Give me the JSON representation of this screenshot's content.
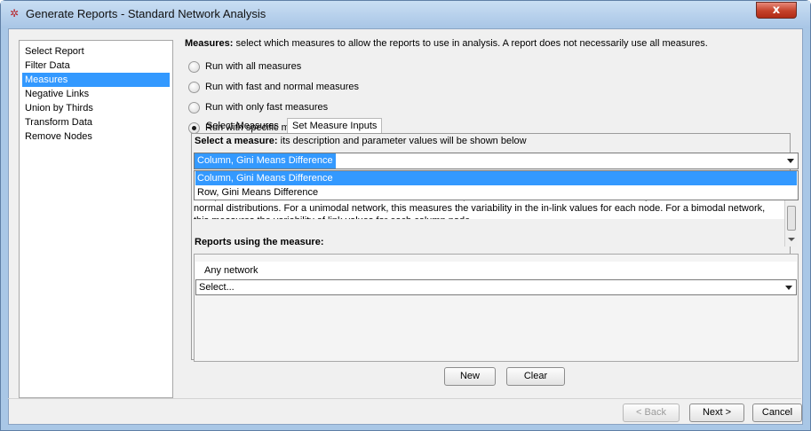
{
  "window": {
    "title": "Generate Reports - Standard Network Analysis",
    "app_icon": "ora-logo-icon",
    "close_glyph": "x"
  },
  "nav": {
    "items": [
      {
        "label": "Select Report",
        "selected": false
      },
      {
        "label": "Filter Data",
        "selected": false
      },
      {
        "label": "Measures",
        "selected": true
      },
      {
        "label": "Negative Links",
        "selected": false
      },
      {
        "label": "Union by Thirds",
        "selected": false
      },
      {
        "label": "Transform Data",
        "selected": false
      },
      {
        "label": "Remove Nodes",
        "selected": false
      }
    ]
  },
  "measures": {
    "heading_bold": "Measures:",
    "heading_rest": " select which measures to allow the reports to use in analysis. A report does not necessarily use all measures.",
    "options": [
      {
        "label": "Run with all measures",
        "checked": false
      },
      {
        "label": "Run with fast and normal measures",
        "checked": false
      },
      {
        "label": "Run with only fast measures",
        "checked": false
      },
      {
        "label": "Run with specific measures",
        "checked": true
      }
    ]
  },
  "tabs": [
    {
      "label": "Select Measures",
      "active": false
    },
    {
      "label": "Set Measure Inputs",
      "active": true
    }
  ],
  "measure_select": {
    "label_bold": "Select a measure:",
    "label_rest": " its description and parameter values will be shown below",
    "current_value": "Column, Gini Means Difference",
    "dropdown_options": [
      {
        "label": "Column, Gini Means Difference",
        "selected": true
      },
      {
        "label": "Row, Gini Means Difference",
        "selected": false
      }
    ],
    "description": "Computes the Gini Means Difference for each column in the input network. This is a measure of variability well-suited for data from non-normal distributions. For a unimodal network, this measures the variability in the in-link values for each node. For a bimodal network, this measures the variability of link values for each column node."
  },
  "reports": {
    "label": "Reports using the measure:",
    "network_label": "Any network",
    "select_value": "Select..."
  },
  "buttons": {
    "new": "New",
    "clear": "Clear",
    "back": "< Back",
    "next": "Next >",
    "cancel": "Cancel"
  },
  "colors": {
    "selection": "#3399ff",
    "titlebar": "#a9c6e6",
    "close": "#c4412a"
  }
}
